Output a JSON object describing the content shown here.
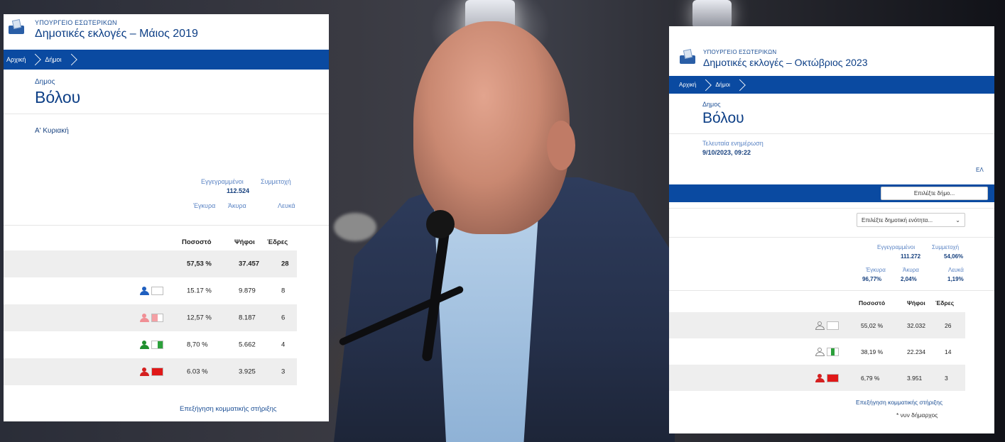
{
  "colors": {
    "brand_blue": "#0a4aa1",
    "title_blue": "#0d3f86",
    "row_shade": "#eeeeee"
  },
  "left": {
    "ministry": "ΥΠΟΥΡΓΕΙΟ ΕΣΩΤΕΡΙΚΩΝ",
    "title": "Δημοτικές εκλογές – Μάιος 2019",
    "breadcrumb": [
      "Αρχική",
      "Δήμοι"
    ],
    "muni_label": "Δημος",
    "muni_name": "Βόλου",
    "round": "Α' Κυριακή",
    "stats": {
      "registered_label": "Εγγεγραμμένοι",
      "registered_value": "112.524",
      "turnout_label": "Συμμετοχή",
      "valid_label": "Έγκυρα",
      "invalid_label": "Άκυρα",
      "blank_label": "Λευκά"
    },
    "table": {
      "headers": [
        "Ποσοστό",
        "Ψήφοι",
        "Έδρες"
      ],
      "rows": [
        {
          "pct": "57,53 %",
          "votes": "37.457",
          "seats": "28",
          "icon": "none",
          "flag": [
            "none"
          ]
        },
        {
          "pct": "15.17 %",
          "votes": "9.879",
          "seats": "8",
          "icon": "person-blue-icon",
          "person_color": "#1f5fbf",
          "flag": [
            "#ffffff"
          ]
        },
        {
          "pct": "12,57 %",
          "votes": "8.187",
          "seats": "6",
          "icon": "person-pink-icon",
          "person_color": "#f08f95",
          "flag": [
            "#f4a0a5",
            "#ffffff"
          ]
        },
        {
          "pct": "8,70 %",
          "votes": "5.662",
          "seats": "4",
          "icon": "person-green-icon",
          "person_color": "#1f8f2e",
          "flag": [
            "#ffffff",
            "#2ca13b"
          ]
        },
        {
          "pct": "6.03 %",
          "votes": "3.925",
          "seats": "3",
          "icon": "person-red-icon",
          "person_color": "#d42020",
          "flag": [
            "#e01818"
          ]
        }
      ]
    },
    "support_link": "Επεξήγηση κομματικής στήριξης"
  },
  "right": {
    "ministry": "ΥΠΟΥΡΓΕΙΟ ΕΣΩΤΕΡΙΚΩΝ",
    "title": "Δημοτικές εκλογές – Οκτώβριος 2023",
    "breadcrumb": [
      "Αρχική",
      "Δήμοι"
    ],
    "muni_label": "Δημος",
    "muni_name": "Βόλου",
    "last_update_label": "Τελευταία ενημέρωση",
    "last_update_value": "9/10/2023, 09:22",
    "lang": "ΕΛ",
    "select_municipality": "Επιλέξτε δήμο...",
    "select_unit": "Επιλέξτε δημοτική ενότητα...",
    "stats": {
      "registered_label": "Εγγεγραμμένοι",
      "registered_value": "111.272",
      "turnout_label": "Συμμετοχή",
      "turnout_value": "54,06%",
      "valid_label": "Έγκυρα",
      "valid_value": "96,77%",
      "invalid_label": "Άκυρα",
      "invalid_value": "2,04%",
      "blank_label": "Λευκά",
      "blank_value": "1,19%"
    },
    "table": {
      "headers": [
        "Ποσοστό",
        "Ψήφοι",
        "Έδρες"
      ],
      "rows": [
        {
          "pct": "55,02 %",
          "votes": "32.032",
          "seats": "26",
          "icon": "person-outline-icon",
          "flag": [
            "#ffffff"
          ]
        },
        {
          "pct": "38,19 %",
          "votes": "22.234",
          "seats": "14",
          "icon": "person-outline-icon",
          "flag": [
            "#ffffff",
            "#2ca13b",
            "#ffffff"
          ]
        },
        {
          "pct": "6,79 %",
          "votes": "3.951",
          "seats": "3",
          "icon": "person-red-icon",
          "person_color": "#d42020",
          "flag": [
            "#e01818"
          ]
        }
      ]
    },
    "support_link": "Επεξήγηση κομματικής στήριξης",
    "footnote": "* νυν δήμαρχος"
  }
}
